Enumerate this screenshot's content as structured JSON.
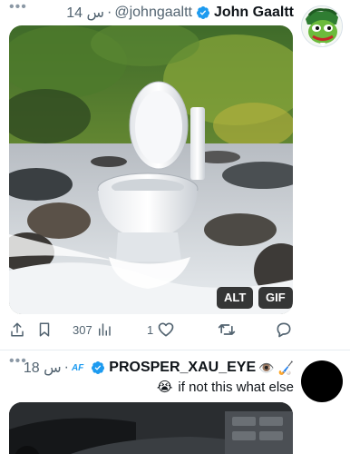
{
  "tweets": [
    {
      "display_name": "John Gaaltt",
      "handle": "@johngaaltt",
      "separator": "·",
      "time": "14 س",
      "media_badges": {
        "alt": "ALT",
        "gif": "GIF"
      },
      "actions": {
        "views": "307",
        "likes": "1"
      },
      "icons": [
        "share-icon",
        "bookmark-icon",
        "views-icon",
        "like-icon",
        "retweet-icon",
        "reply-icon"
      ]
    },
    {
      "display_name": "PROSPER_XAU_EYE",
      "handle_badge": "AF",
      "separator": "·",
      "time": "18 س",
      "name_emojis": [
        "👁️",
        "🏑"
      ],
      "text": "if not this what else",
      "text_emoji": "😭"
    }
  ],
  "colors": {
    "verified": "#1d9bf0",
    "secondary_text": "#536471",
    "primary_text": "#0f1419",
    "divider": "#e6ecf0"
  }
}
